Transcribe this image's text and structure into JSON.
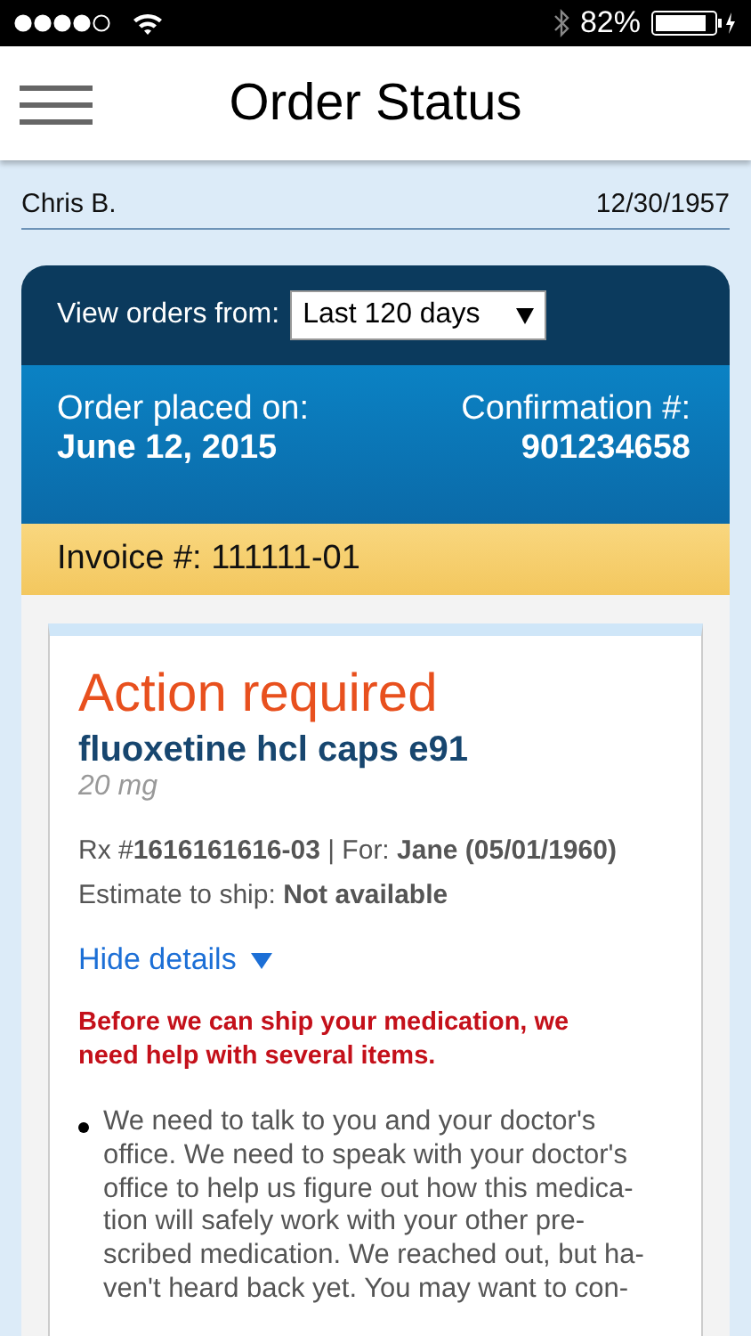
{
  "status_bar": {
    "battery": "82%"
  },
  "header": {
    "title": "Order Status"
  },
  "patient": {
    "name": "Chris B.",
    "birth_date": "12/30/1957"
  },
  "filter": {
    "label": "View orders from:",
    "value": "Last 120 days"
  },
  "order": {
    "placed_label": "Order placed on:",
    "placed_date": "June 12, 2015",
    "confirmation_label": "Confirmation #:",
    "confirmation_number": "901234658"
  },
  "invoice": "Invoice #: 111111-01",
  "item": {
    "status": "Action required",
    "drug": "fluoxetine hcl caps e91",
    "strength": "20 mg",
    "rx_line": "Rx #**1616161616-03** | For: **Jane (05/01/1960)**",
    "estimate": "Estimate to ship: **Not available**",
    "details_toggle": {
      "label": "Hide details",
      "expanded": true
    },
    "alert": "Before we can ship your medication, we need help with several items.",
    "issues": [
      "We need to talk to you and your doctor's\noffice. We need to speak with your doctor's\noffice to help us figure out how this medica-\ntion will safely work with your other pre-\nscribed medication. We reached out, but ha-\nven't heard back yet. You may want to con-"
    ]
  }
}
